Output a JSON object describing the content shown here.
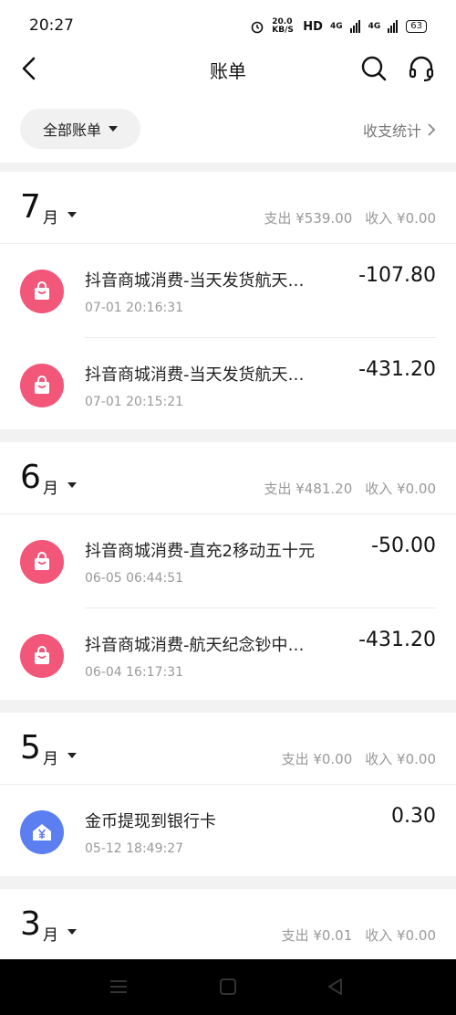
{
  "status": {
    "time": "20:27",
    "speed": "20.0 KB/S",
    "hd": "HD",
    "net1": "4G",
    "net2": "4G",
    "battery": "63"
  },
  "header": {
    "title": "账单"
  },
  "filter": {
    "label": "全部账单",
    "stats": "收支统计"
  },
  "months": [
    {
      "month": "7",
      "unit": "月",
      "expense": "支出 ¥539.00",
      "income": "收入 ¥0.00",
      "items": [
        {
          "name": "抖音商城消费-当天发货航天…",
          "date": "07-01 20:16:31",
          "amount": "-107.80",
          "icon": "shopping-bag-icon"
        },
        {
          "name": "抖音商城消费-当天发货航天…",
          "date": "07-01 20:15:21",
          "amount": "-431.20",
          "icon": "shopping-bag-icon"
        }
      ]
    },
    {
      "month": "6",
      "unit": "月",
      "expense": "支出 ¥481.20",
      "income": "收入 ¥0.00",
      "items": [
        {
          "name": "抖音商城消费-直充2移动五十元",
          "date": "06-05 06:44:51",
          "amount": "-50.00",
          "icon": "shopping-bag-icon"
        },
        {
          "name": "抖音商城消费-航天纪念钞中…",
          "date": "06-04 16:17:31",
          "amount": "-431.20",
          "icon": "shopping-bag-icon"
        }
      ]
    },
    {
      "month": "5",
      "unit": "月",
      "expense": "支出 ¥0.00",
      "income": "收入 ¥0.00",
      "items": [
        {
          "name": "金币提现到银行卡",
          "date": "05-12 18:49:27",
          "amount": "0.30",
          "icon": "yuan-house-icon"
        }
      ]
    },
    {
      "month": "3",
      "unit": "月",
      "expense": "支出 ¥0.01",
      "income": "收入 ¥0.00",
      "items": []
    }
  ],
  "colors": {
    "shopping": "#f2577a",
    "withdraw": "#5b7ff0"
  }
}
